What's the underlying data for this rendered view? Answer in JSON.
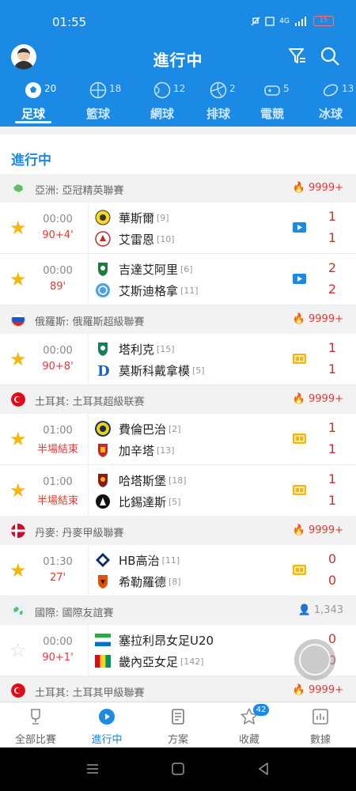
{
  "status": {
    "time": "01:55",
    "network": "4G",
    "battery": "15"
  },
  "header": {
    "title": "進行中"
  },
  "tabs": [
    {
      "label": "足球",
      "count": "20",
      "icon": "soccer-ball-icon"
    },
    {
      "label": "籃球",
      "count": "18",
      "icon": "basketball-icon"
    },
    {
      "label": "網球",
      "count": "12",
      "icon": "tennis-ball-icon"
    },
    {
      "label": "排球",
      "count": "2",
      "icon": "volleyball-icon"
    },
    {
      "label": "電競",
      "count": "5",
      "icon": "gamepad-icon"
    },
    {
      "label": "冰球",
      "count": "13",
      "icon": "hockey-puck-icon"
    }
  ],
  "section_title": "進行中",
  "groups": [
    {
      "league": "亞洲: 亞冠精英聯賽",
      "hot": "9999+",
      "matches": [
        {
          "time": "00:00",
          "status": "90+4'",
          "home": "華斯爾",
          "home_rank": "[9]",
          "away": "艾雷恩",
          "away_rank": "[10]",
          "home_score": "1",
          "away_score": "1",
          "starred": true,
          "media": "video"
        },
        {
          "time": "00:00",
          "status": "89'",
          "home": "吉達艾阿里",
          "home_rank": "[6]",
          "away": "艾斯迪格拿",
          "away_rank": "[11]",
          "home_score": "2",
          "away_score": "2",
          "starred": true,
          "media": "video"
        }
      ]
    },
    {
      "league": "俄羅斯: 俄羅斯超級聯賽",
      "hot": "9999+",
      "matches": [
        {
          "time": "00:00",
          "status": "90+8'",
          "home": "塔利克",
          "home_rank": "[15]",
          "away": "莫斯科戴拿模",
          "away_rank": "[5]",
          "home_score": "1",
          "away_score": "1",
          "starred": true,
          "media": "animation"
        }
      ]
    },
    {
      "league": "土耳其: 土耳其超級联赛",
      "hot": "9999+",
      "matches": [
        {
          "time": "01:00",
          "status": "半場結束",
          "home": "費倫巴治",
          "home_rank": "[2]",
          "away": "加辛塔",
          "away_rank": "[13]",
          "home_score": "1",
          "away_score": "1",
          "starred": true,
          "media": "animation"
        },
        {
          "time": "01:00",
          "status": "半場結束",
          "home": "哈塔斯堡",
          "home_rank": "[18]",
          "away": "比錫達斯",
          "away_rank": "[5]",
          "home_score": "1",
          "away_score": "1",
          "starred": true,
          "media": "animation"
        }
      ]
    },
    {
      "league": "丹麥: 丹麥甲級聯賽",
      "hot": "9999+",
      "matches": [
        {
          "time": "01:30",
          "status": "27'",
          "home": "HB高治",
          "home_rank": "[11]",
          "away": "希勒羅德",
          "away_rank": "[8]",
          "home_score": "0",
          "away_score": "0",
          "starred": true,
          "media": "animation"
        }
      ]
    },
    {
      "league": "國際: 國際友誼賽",
      "hot": "1,343",
      "matches": [
        {
          "time": "00:00",
          "status": "90+1'",
          "home": "塞拉利昂女足U20",
          "home_rank": "",
          "away": "畿內亞女足",
          "away_rank": "[142]",
          "home_score": "0",
          "away_score": "0",
          "starred": false,
          "media": ""
        }
      ]
    },
    {
      "league": "土耳其: 土耳其甲級聯賽",
      "hot": "9999+",
      "matches": []
    }
  ],
  "bottom_nav": [
    {
      "label": "全部比賽",
      "icon": "trophy-icon"
    },
    {
      "label": "進行中",
      "icon": "play-circle-icon"
    },
    {
      "label": "方案",
      "icon": "document-icon"
    },
    {
      "label": "收藏",
      "icon": "star-icon",
      "badge": "42"
    },
    {
      "label": "數據",
      "icon": "bar-chart-icon"
    }
  ],
  "colors": {
    "brand": "#1a8ae5",
    "score": "#d32f2f",
    "star": "#f5b70a"
  }
}
